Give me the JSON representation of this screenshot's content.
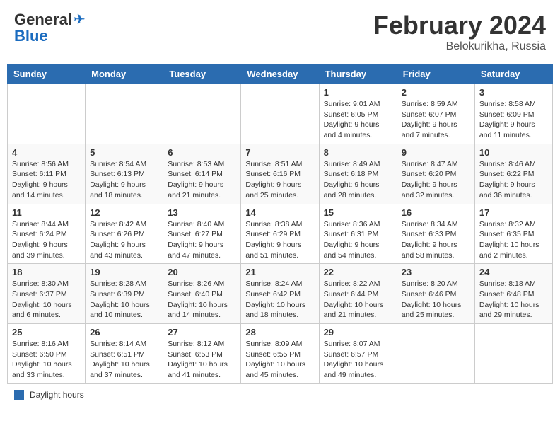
{
  "header": {
    "logo_general": "General",
    "logo_blue": "Blue",
    "month_year": "February 2024",
    "location": "Belokurikha, Russia"
  },
  "days_of_week": [
    "Sunday",
    "Monday",
    "Tuesday",
    "Wednesday",
    "Thursday",
    "Friday",
    "Saturday"
  ],
  "weeks": [
    [
      {
        "day": "",
        "info": ""
      },
      {
        "day": "",
        "info": ""
      },
      {
        "day": "",
        "info": ""
      },
      {
        "day": "",
        "info": ""
      },
      {
        "day": "1",
        "info": "Sunrise: 9:01 AM\nSunset: 6:05 PM\nDaylight: 9 hours\nand 4 minutes."
      },
      {
        "day": "2",
        "info": "Sunrise: 8:59 AM\nSunset: 6:07 PM\nDaylight: 9 hours\nand 7 minutes."
      },
      {
        "day": "3",
        "info": "Sunrise: 8:58 AM\nSunset: 6:09 PM\nDaylight: 9 hours\nand 11 minutes."
      }
    ],
    [
      {
        "day": "4",
        "info": "Sunrise: 8:56 AM\nSunset: 6:11 PM\nDaylight: 9 hours\nand 14 minutes."
      },
      {
        "day": "5",
        "info": "Sunrise: 8:54 AM\nSunset: 6:13 PM\nDaylight: 9 hours\nand 18 minutes."
      },
      {
        "day": "6",
        "info": "Sunrise: 8:53 AM\nSunset: 6:14 PM\nDaylight: 9 hours\nand 21 minutes."
      },
      {
        "day": "7",
        "info": "Sunrise: 8:51 AM\nSunset: 6:16 PM\nDaylight: 9 hours\nand 25 minutes."
      },
      {
        "day": "8",
        "info": "Sunrise: 8:49 AM\nSunset: 6:18 PM\nDaylight: 9 hours\nand 28 minutes."
      },
      {
        "day": "9",
        "info": "Sunrise: 8:47 AM\nSunset: 6:20 PM\nDaylight: 9 hours\nand 32 minutes."
      },
      {
        "day": "10",
        "info": "Sunrise: 8:46 AM\nSunset: 6:22 PM\nDaylight: 9 hours\nand 36 minutes."
      }
    ],
    [
      {
        "day": "11",
        "info": "Sunrise: 8:44 AM\nSunset: 6:24 PM\nDaylight: 9 hours\nand 39 minutes."
      },
      {
        "day": "12",
        "info": "Sunrise: 8:42 AM\nSunset: 6:26 PM\nDaylight: 9 hours\nand 43 minutes."
      },
      {
        "day": "13",
        "info": "Sunrise: 8:40 AM\nSunset: 6:27 PM\nDaylight: 9 hours\nand 47 minutes."
      },
      {
        "day": "14",
        "info": "Sunrise: 8:38 AM\nSunset: 6:29 PM\nDaylight: 9 hours\nand 51 minutes."
      },
      {
        "day": "15",
        "info": "Sunrise: 8:36 AM\nSunset: 6:31 PM\nDaylight: 9 hours\nand 54 minutes."
      },
      {
        "day": "16",
        "info": "Sunrise: 8:34 AM\nSunset: 6:33 PM\nDaylight: 9 hours\nand 58 minutes."
      },
      {
        "day": "17",
        "info": "Sunrise: 8:32 AM\nSunset: 6:35 PM\nDaylight: 10 hours\nand 2 minutes."
      }
    ],
    [
      {
        "day": "18",
        "info": "Sunrise: 8:30 AM\nSunset: 6:37 PM\nDaylight: 10 hours\nand 6 minutes."
      },
      {
        "day": "19",
        "info": "Sunrise: 8:28 AM\nSunset: 6:39 PM\nDaylight: 10 hours\nand 10 minutes."
      },
      {
        "day": "20",
        "info": "Sunrise: 8:26 AM\nSunset: 6:40 PM\nDaylight: 10 hours\nand 14 minutes."
      },
      {
        "day": "21",
        "info": "Sunrise: 8:24 AM\nSunset: 6:42 PM\nDaylight: 10 hours\nand 18 minutes."
      },
      {
        "day": "22",
        "info": "Sunrise: 8:22 AM\nSunset: 6:44 PM\nDaylight: 10 hours\nand 21 minutes."
      },
      {
        "day": "23",
        "info": "Sunrise: 8:20 AM\nSunset: 6:46 PM\nDaylight: 10 hours\nand 25 minutes."
      },
      {
        "day": "24",
        "info": "Sunrise: 8:18 AM\nSunset: 6:48 PM\nDaylight: 10 hours\nand 29 minutes."
      }
    ],
    [
      {
        "day": "25",
        "info": "Sunrise: 8:16 AM\nSunset: 6:50 PM\nDaylight: 10 hours\nand 33 minutes."
      },
      {
        "day": "26",
        "info": "Sunrise: 8:14 AM\nSunset: 6:51 PM\nDaylight: 10 hours\nand 37 minutes."
      },
      {
        "day": "27",
        "info": "Sunrise: 8:12 AM\nSunset: 6:53 PM\nDaylight: 10 hours\nand 41 minutes."
      },
      {
        "day": "28",
        "info": "Sunrise: 8:09 AM\nSunset: 6:55 PM\nDaylight: 10 hours\nand 45 minutes."
      },
      {
        "day": "29",
        "info": "Sunrise: 8:07 AM\nSunset: 6:57 PM\nDaylight: 10 hours\nand 49 minutes."
      },
      {
        "day": "",
        "info": ""
      },
      {
        "day": "",
        "info": ""
      }
    ]
  ],
  "legend": {
    "label": "Daylight hours"
  }
}
